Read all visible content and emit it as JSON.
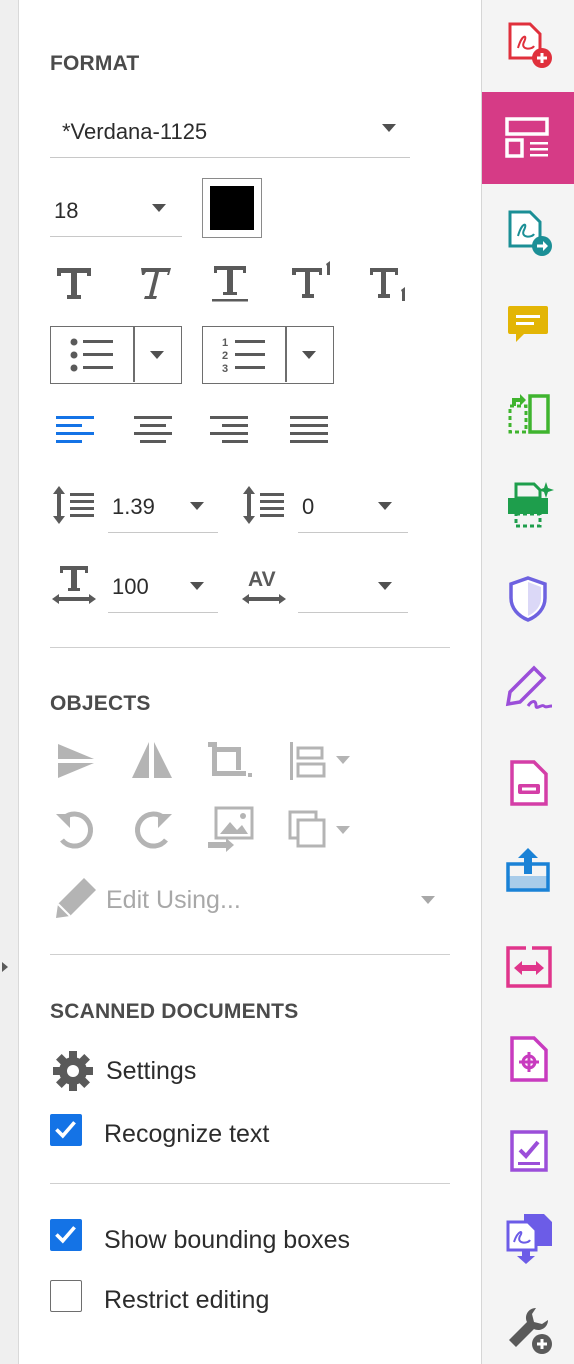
{
  "format": {
    "title": "FORMAT",
    "font_family": "*Verdana-1125",
    "font_size": "18",
    "text_color": "#000000",
    "line_spacing": "1.39",
    "paragraph_spacing": "0",
    "horizontal_scale": "100",
    "character_spacing": ""
  },
  "objects": {
    "title": "OBJECTS",
    "edit_using": "Edit Using..."
  },
  "scanned": {
    "title": "SCANNED DOCUMENTS",
    "settings": "Settings",
    "recognize_text": "Recognize text",
    "recognize_text_checked": true
  },
  "options": {
    "show_bounding_boxes": "Show bounding boxes",
    "show_bounding_boxes_checked": true,
    "restrict_editing": "Restrict editing",
    "restrict_editing_checked": false
  },
  "colors": {
    "accent": "#1473e6",
    "active_tool": "#d63b86"
  },
  "toolbar": [
    "create-pdf-icon",
    "edit-pdf-icon",
    "export-pdf-icon",
    "comment-icon",
    "organize-pages-icon",
    "print-production-icon",
    "protect-icon",
    "fill-sign-icon",
    "redact-icon",
    "share-icon",
    "compare-icon",
    "prepare-form-icon",
    "request-signatures-icon",
    "combine-files-icon",
    "more-tools-icon"
  ]
}
